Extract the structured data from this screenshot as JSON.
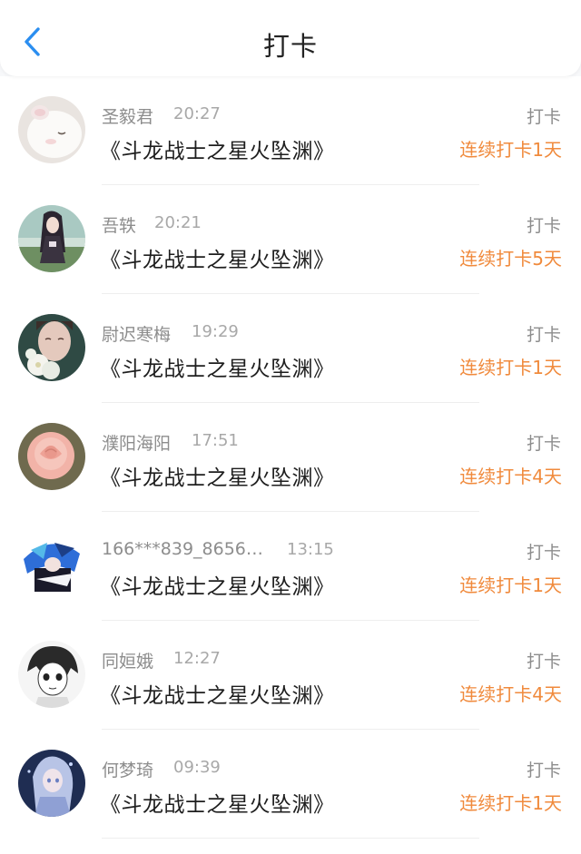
{
  "header": {
    "title": "打卡",
    "back_icon": "chevron-left-icon",
    "accent_color": "#2b8ef0"
  },
  "checkin_label": "打卡",
  "streak_color": "#f08a3c",
  "items": [
    {
      "username": "圣毅君",
      "time": "20:27",
      "book": "《斗龙战士之星火坠渊》",
      "streak": "连续打卡1天",
      "avatar": "white-bunny-plush"
    },
    {
      "username": "吾轶",
      "time": "20:21",
      "book": "《斗龙战士之星火坠渊》",
      "streak": "连续打卡5天",
      "avatar": "anime-girl-dark-hair"
    },
    {
      "username": "尉迟寒梅",
      "time": "19:29",
      "book": "《斗龙战士之星火坠渊》",
      "streak": "连续打卡1天",
      "avatar": "portrait-with-white-flowers"
    },
    {
      "username": "濮阳海阳",
      "time": "17:51",
      "book": "《斗龙战士之星火坠渊》",
      "streak": "连续打卡4天",
      "avatar": "pink-rose"
    },
    {
      "username": "166***839_8656…",
      "time": "13:15",
      "book": "《斗龙战士之星火坠渊》",
      "streak": "连续打卡1天",
      "avatar": "blue-anime-character"
    },
    {
      "username": "同姮娥",
      "time": "12:27",
      "book": "《斗龙战士之星火坠渊》",
      "streak": "连续打卡4天",
      "avatar": "manga-sketch-character"
    },
    {
      "username": "何梦琦",
      "time": "09:39",
      "book": "《斗龙战士之星火坠渊》",
      "streak": "连续打卡1天",
      "avatar": "anime-girl-silver-hair"
    }
  ]
}
